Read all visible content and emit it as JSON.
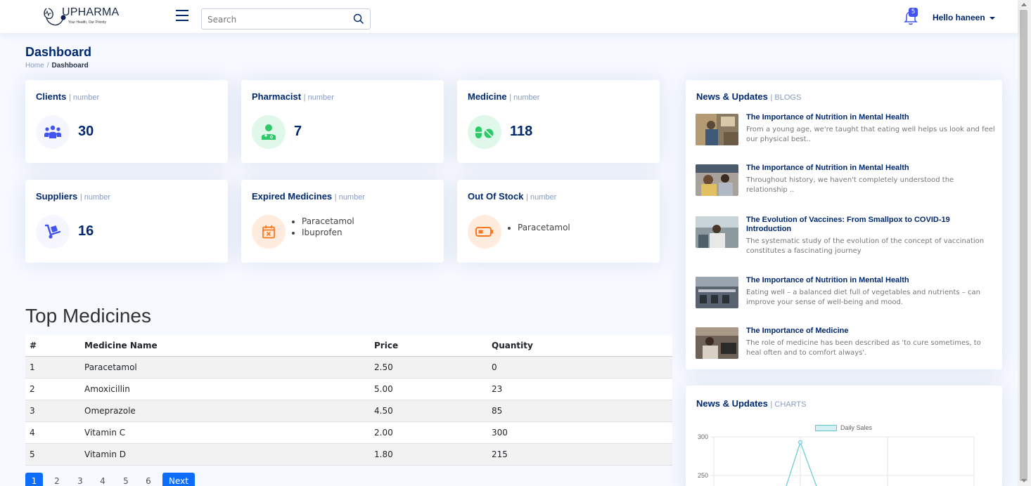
{
  "header": {
    "logo_text": "UPHARMA",
    "logo_tagline": "Your Health, Our Priority",
    "search_placeholder": "Search",
    "notification_count": "5",
    "profile_label": "Hello haneen"
  },
  "page": {
    "title": "Dashboard",
    "breadcrumb": [
      "Home",
      "Dashboard"
    ]
  },
  "stats": {
    "clients": {
      "label": "Clients",
      "sub": "| number",
      "value": "30",
      "icon": "users-icon",
      "color": "#4154f1",
      "bg": "#f6f6fe"
    },
    "pharmacist": {
      "label": "Pharmacist",
      "sub": "| number",
      "value": "7",
      "icon": "doctor-icon",
      "color": "#2eca6a",
      "bg": "#e0f8e9"
    },
    "medicine": {
      "label": "Medicine",
      "sub": "| number",
      "value": "118",
      "icon": "pills-icon",
      "color": "#2eca6a",
      "bg": "#e0f8e9"
    },
    "suppliers": {
      "label": "Suppliers",
      "sub": "| number",
      "value": "16",
      "icon": "dolly-icon",
      "color": "#4154f1",
      "bg": "#f6f6fe"
    },
    "expired": {
      "label": "Expired Medicines",
      "sub": "| number",
      "items": [
        "Paracetamol",
        "Ibuprofen"
      ],
      "icon": "calendar-x-icon",
      "color": "#ff771d",
      "bg": "#ffecdf"
    },
    "out_of_stock": {
      "label": "Out Of Stock",
      "sub": "| number",
      "items": [
        "Paracetamol"
      ],
      "icon": "battery-empty-icon",
      "color": "#ff771d",
      "bg": "#ffecdf"
    }
  },
  "top_medicines": {
    "title": "Top Medicines",
    "columns": [
      "#",
      "Medicine Name",
      "Price",
      "Quantity"
    ],
    "rows": [
      [
        "1",
        "Paracetamol",
        "2.50",
        "0"
      ],
      [
        "2",
        "Amoxicillin",
        "5.00",
        "23"
      ],
      [
        "3",
        "Omeprazole",
        "4.50",
        "85"
      ],
      [
        "4",
        "Vitamin C",
        "2.00",
        "300"
      ],
      [
        "5",
        "Vitamin D",
        "1.80",
        "215"
      ]
    ],
    "pagination": [
      "1",
      "2",
      "3",
      "4",
      "5",
      "6"
    ],
    "next_label": "Next"
  },
  "news": {
    "title": "News & Updates",
    "sub": "| BLOGS",
    "items": [
      {
        "title": "The Importance of Nutrition in Mental Health",
        "body": "From a young age, we're taught that eating well helps us look and feel our physical best.."
      },
      {
        "title": "The Importance of Nutrition in Mental Health",
        "body": "Throughout history, we haven't completely understood the relationship .."
      },
      {
        "title": "The Evolution of Vaccines: From Smallpox to COVID-19 Introduction",
        "body": "The systematic study of the evolution of the concept of vaccination constitutes a fascinating journey"
      },
      {
        "title": "The Importance of Nutrition in Mental Health",
        "body": "Eating well – a balanced diet full of vegetables and nutrients – can improve your sense of well-being and mood."
      },
      {
        "title": "The Importance of Medicine",
        "body": "The role of medicine has been described as 'to cure sometimes, to heal often and to comfort always'."
      }
    ]
  },
  "charts_panel": {
    "title": "News & Updates",
    "sub": "| CHARTS"
  },
  "chart_data": {
    "type": "line",
    "series": [
      {
        "name": "Daily Sales",
        "color": "#64c8d2",
        "points_visible": [
          {
            "y": 293
          }
        ]
      }
    ],
    "yticks": [
      "300",
      "250"
    ],
    "ylim": [
      230,
      300
    ],
    "grid": true,
    "legend": "top"
  }
}
